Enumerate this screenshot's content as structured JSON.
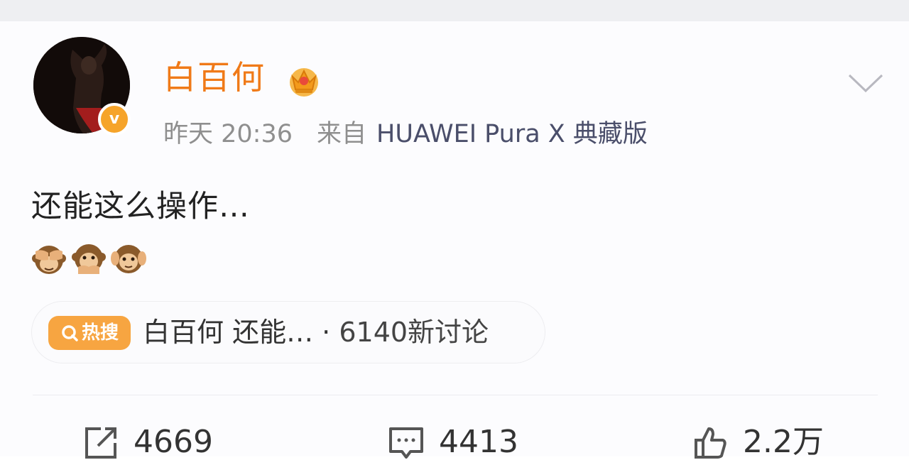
{
  "post": {
    "user": {
      "name": "白百何",
      "verified": true
    },
    "time": "昨天 20:36",
    "source_prefix": "来自",
    "device": "HUAWEI Pura X 典藏版",
    "text": "还能这么操作…",
    "emojis": [
      "see-no-evil-monkey",
      "speak-no-evil-monkey",
      "hear-no-evil-monkey"
    ]
  },
  "hot_search": {
    "tag": "热搜",
    "title": "白百何 还能… ·",
    "count": "6140新讨论"
  },
  "actions": {
    "share_count": "4669",
    "comment_count": "4413",
    "like_count": "2.2万"
  },
  "colors": {
    "name": "#f07a18",
    "hot_tag": "#f7a541",
    "badge": "#f6a42a",
    "device": "#4a4e6a"
  }
}
